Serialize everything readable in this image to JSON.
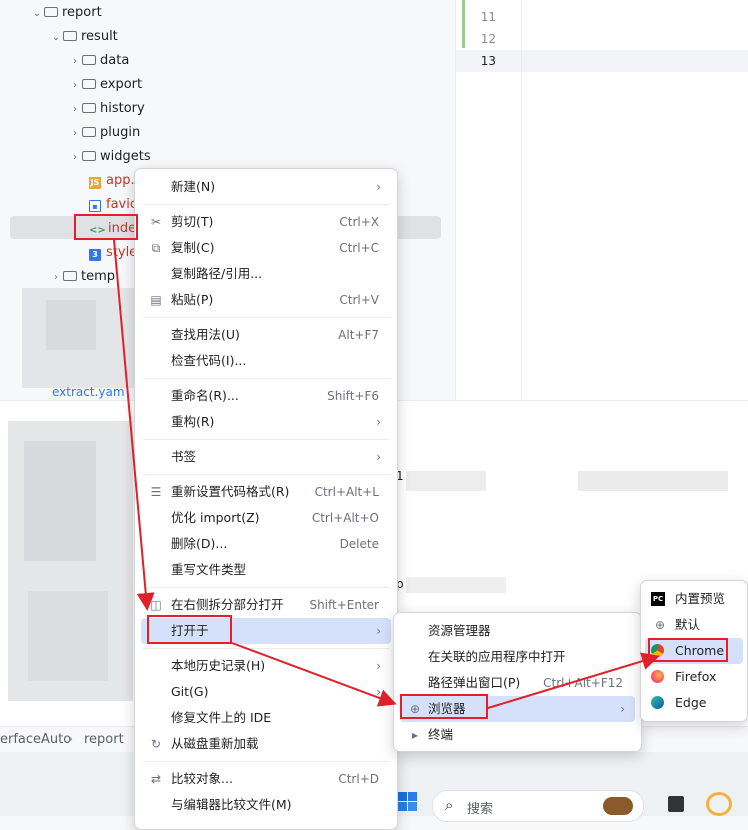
{
  "tree": {
    "items": [
      {
        "label": "report",
        "indent": 1,
        "kind": "folder",
        "expanded": true
      },
      {
        "label": "result",
        "indent": 2,
        "kind": "folder",
        "expanded": true
      },
      {
        "label": "data",
        "indent": 3,
        "kind": "folder",
        "expanded": false
      },
      {
        "label": "export",
        "indent": 3,
        "kind": "folder",
        "expanded": false
      },
      {
        "label": "history",
        "indent": 3,
        "kind": "folder",
        "expanded": false
      },
      {
        "label": "plugin",
        "indent": 3,
        "kind": "folder",
        "expanded": false
      },
      {
        "label": "widgets",
        "indent": 3,
        "kind": "folder",
        "expanded": false
      },
      {
        "label": "app.j",
        "indent": 3,
        "kind": "js"
      },
      {
        "label": "favic",
        "indent": 3,
        "kind": "img"
      },
      {
        "label": "inde:",
        "indent": 3,
        "kind": "html"
      },
      {
        "label": "style",
        "indent": 3,
        "kind": "css"
      },
      {
        "label": "temp",
        "indent": 2,
        "kind": "folder",
        "expanded": false
      }
    ],
    "extract_label": "extract.yam"
  },
  "editor": {
    "line_numbers": [
      "11",
      "12",
      "13"
    ]
  },
  "console": {
    "fragment_1": "1",
    "fragment_2": "p"
  },
  "statusbar": {
    "crumbs": [
      "erfaceAuto",
      "report"
    ]
  },
  "taskbar": {
    "search_placeholder": "搜索"
  },
  "context_menu": {
    "items": [
      {
        "label": "新建(N)",
        "shortcut": "",
        "submenu": true,
        "icon": ""
      },
      {
        "label": "剪切(T)",
        "shortcut": "Ctrl+X",
        "submenu": false,
        "icon": "scissors"
      },
      {
        "label": "复制(C)",
        "shortcut": "Ctrl+C",
        "submenu": false,
        "icon": "copy"
      },
      {
        "label": "复制路径/引用...",
        "shortcut": "",
        "submenu": false,
        "icon": ""
      },
      {
        "label": "粘贴(P)",
        "shortcut": "Ctrl+V",
        "submenu": false,
        "icon": "paste"
      },
      {
        "label": "查找用法(U)",
        "shortcut": "Alt+F7",
        "submenu": false,
        "icon": ""
      },
      {
        "label": "检查代码(I)...",
        "shortcut": "",
        "submenu": false,
        "icon": ""
      },
      {
        "label": "重命名(R)...",
        "shortcut": "Shift+F6",
        "submenu": false,
        "icon": ""
      },
      {
        "label": "重构(R)",
        "shortcut": "",
        "submenu": true,
        "icon": ""
      },
      {
        "label": "书签",
        "shortcut": "",
        "submenu": true,
        "icon": ""
      },
      {
        "label": "重新设置代码格式(R)",
        "shortcut": "Ctrl+Alt+L",
        "submenu": false,
        "icon": "format"
      },
      {
        "label": "优化 import(Z)",
        "shortcut": "Ctrl+Alt+O",
        "submenu": false,
        "icon": ""
      },
      {
        "label": "删除(D)...",
        "shortcut": "Delete",
        "submenu": false,
        "icon": ""
      },
      {
        "label": "重写文件类型",
        "shortcut": "",
        "submenu": false,
        "icon": ""
      },
      {
        "label": "在右侧拆分部分打开",
        "shortcut": "Shift+Enter",
        "submenu": false,
        "icon": "split"
      },
      {
        "label": "打开于",
        "shortcut": "",
        "submenu": true,
        "icon": ""
      },
      {
        "label": "本地历史记录(H)",
        "shortcut": "",
        "submenu": true,
        "icon": ""
      },
      {
        "label": "Git(G)",
        "shortcut": "",
        "submenu": true,
        "icon": ""
      },
      {
        "label": "修复文件上的 IDE",
        "shortcut": "",
        "submenu": false,
        "icon": ""
      },
      {
        "label": "从磁盘重新加载",
        "shortcut": "",
        "submenu": false,
        "icon": "reload"
      },
      {
        "label": "比较对象...",
        "shortcut": "Ctrl+D",
        "submenu": false,
        "icon": "compare"
      },
      {
        "label": "与编辑器比较文件(M)",
        "shortcut": "",
        "submenu": false,
        "icon": ""
      }
    ]
  },
  "open_in_menu": {
    "items": [
      {
        "label": "资源管理器",
        "shortcut": "",
        "submenu": false,
        "icon": ""
      },
      {
        "label": "在关联的应用程序中打开",
        "shortcut": "",
        "submenu": false,
        "icon": ""
      },
      {
        "label": "路径弹出窗口(P)",
        "shortcut": "Ctrl+Alt+F12",
        "submenu": false,
        "icon": ""
      },
      {
        "label": "浏览器",
        "shortcut": "",
        "submenu": true,
        "icon": "globe"
      },
      {
        "label": "终端",
        "shortcut": "",
        "submenu": false,
        "icon": "terminal"
      }
    ]
  },
  "browser_menu": {
    "items": [
      {
        "label": "内置预览",
        "icon": "pycharm"
      },
      {
        "label": "默认",
        "icon": "globe"
      },
      {
        "label": "Chrome",
        "icon": "chrome"
      },
      {
        "label": "Firefox",
        "icon": "firefox"
      },
      {
        "label": "Edge",
        "icon": "edge"
      }
    ]
  },
  "colors": {
    "highlight": "#d5e1fa",
    "annotation_red": "#e0202a"
  }
}
